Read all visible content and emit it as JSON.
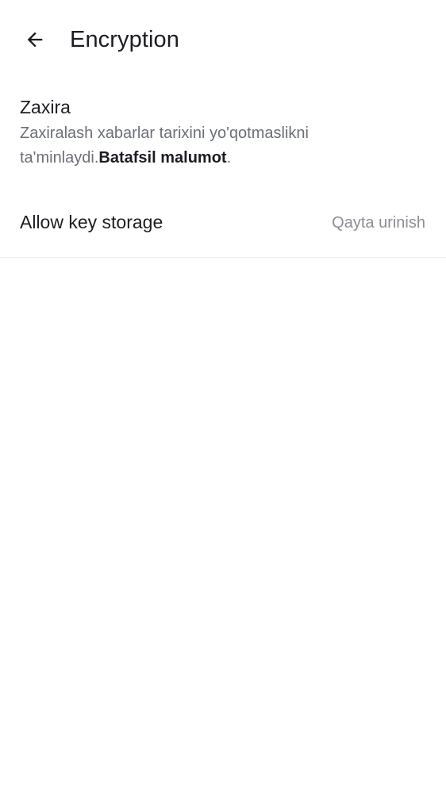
{
  "header": {
    "back_icon": "arrow-left-icon",
    "title": "Encryption"
  },
  "backup": {
    "title": "Zaxira",
    "description": "Zaxiralash xabarlar tarixini yo'qotmaslikni ta'minlaydi.",
    "learn_more": "Batafsil malumot",
    "period": "."
  },
  "key_storage": {
    "label": "Allow key storage",
    "action": "Qayta urinish"
  }
}
